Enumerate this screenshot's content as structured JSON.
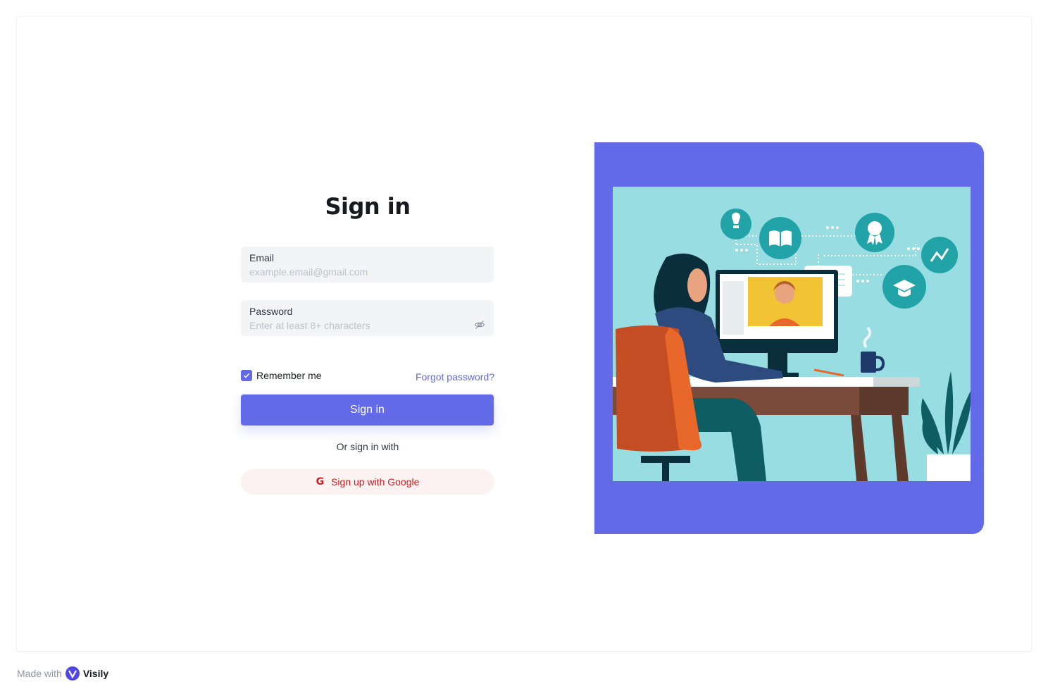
{
  "form": {
    "title": "Sign in",
    "email": {
      "label": "Email",
      "placeholder": "example.email@gmail.com",
      "value": ""
    },
    "password": {
      "label": "Password",
      "placeholder": "Enter at least 8+ characters",
      "value": ""
    },
    "remember": {
      "label": "Remember me",
      "checked": true
    },
    "forgot_label": "Forgot password?",
    "signin_label": "Sign in",
    "or_label": "Or sign in with",
    "google": {
      "icon": "G",
      "label": "Sign up with Google"
    }
  },
  "footer": {
    "made_with": "Made with",
    "brand": "Visily"
  },
  "colors": {
    "primary": "#636ae8",
    "google_text": "#c81e1e",
    "google_bg": "#fdf2f2",
    "input_bg": "#f3f4f6",
    "illustration_bg": "#97dde2"
  },
  "icons": [
    "eye-off-icon",
    "check-icon",
    "google-icon",
    "visily-logo-icon"
  ]
}
